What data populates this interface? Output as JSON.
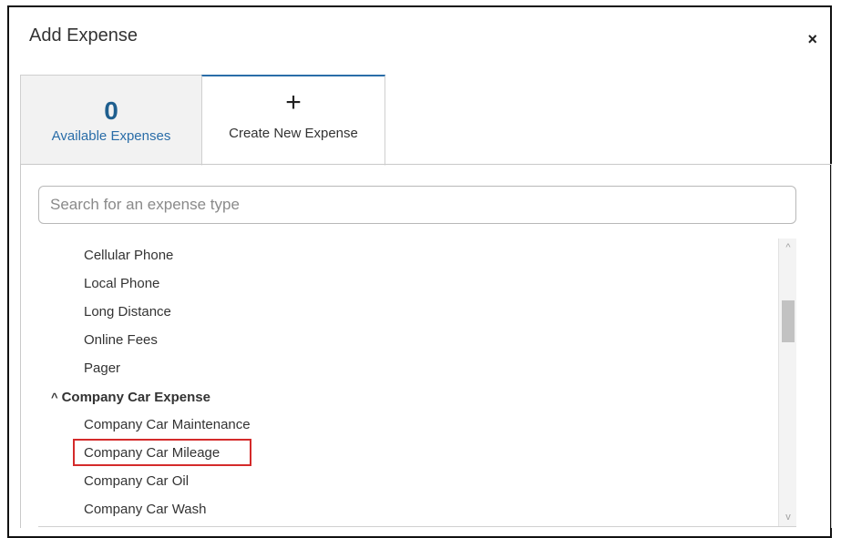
{
  "dialog": {
    "title": "Add Expense",
    "close_label": "×"
  },
  "tabs": {
    "available": {
      "count": "0",
      "label": "Available Expenses"
    },
    "create": {
      "icon": "plus-icon",
      "symbol": "+",
      "label": "Create New Expense"
    }
  },
  "search": {
    "placeholder": "Search for an expense type",
    "value": ""
  },
  "list": {
    "items": [
      "Cellular Phone",
      "Local Phone",
      "Long Distance",
      "Online Fees",
      "Pager"
    ],
    "category": {
      "caret": "^",
      "label": "Company Car Expense"
    },
    "category_items": [
      "Company Car Maintenance",
      "Company Car Mileage",
      "Company Car Oil",
      "Company Car Wash"
    ],
    "highlighted_item": "Company Car Mileage"
  },
  "colors": {
    "accent": "#2a6da8",
    "count": "#1f5f8f",
    "highlight": "#d42a2a"
  },
  "scrollbar": {
    "up_symbol": "^",
    "down_symbol": "v"
  }
}
